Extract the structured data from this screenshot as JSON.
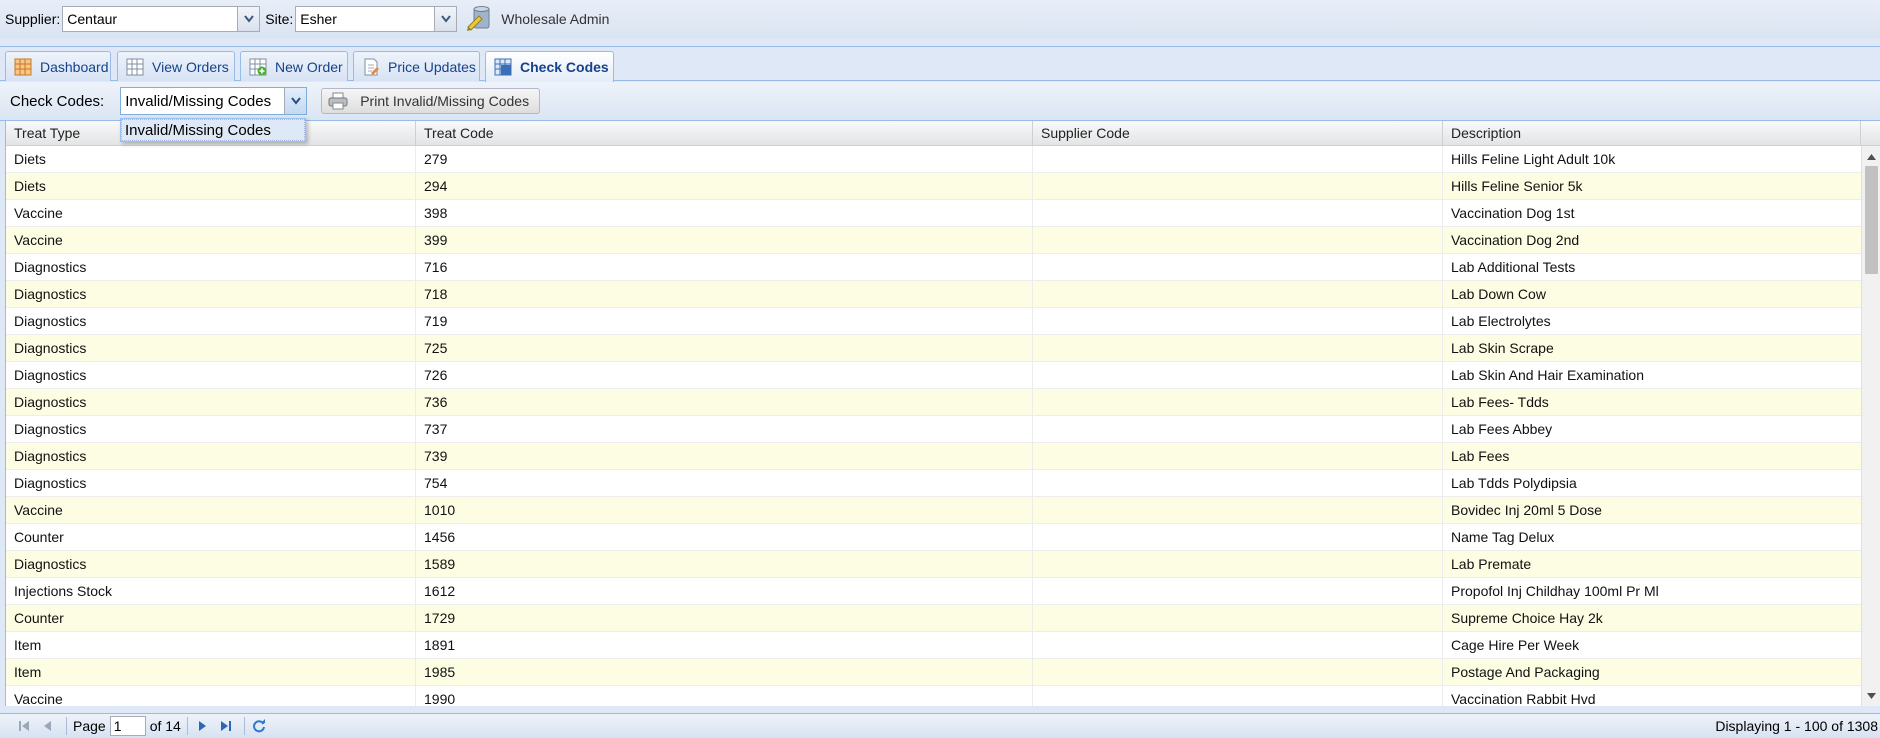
{
  "header": {
    "supplier_label": "Supplier:",
    "supplier_value": "Centaur",
    "site_label": "Site:",
    "site_value": "Esher",
    "admin_link": "Wholesale Admin"
  },
  "tabs": [
    {
      "label": "Dashboard",
      "icon": "dashboard-grid-icon",
      "active": false
    },
    {
      "label": "View Orders",
      "icon": "table-icon",
      "active": false
    },
    {
      "label": "New Order",
      "icon": "table-add-icon",
      "active": false
    },
    {
      "label": "Price Updates",
      "icon": "document-edit-icon",
      "active": false
    },
    {
      "label": "Check Codes",
      "icon": "table-check-icon",
      "active": true
    }
  ],
  "toolbar": {
    "check_codes_label": "Check Codes:",
    "check_codes_value": "Invalid/Missing Codes",
    "print_button": "Print Invalid/Missing Codes",
    "dropdown_options": [
      "Invalid/Missing Codes"
    ]
  },
  "grid": {
    "columns": [
      "Treat Type",
      "Treat Code",
      "Supplier Code",
      "Description"
    ],
    "rows": [
      [
        "Diets",
        "279",
        "",
        "Hills Feline Light Adult 10k"
      ],
      [
        "Diets",
        "294",
        "",
        "Hills Feline Senior 5k"
      ],
      [
        "Vaccine",
        "398",
        "",
        "Vaccination Dog 1st"
      ],
      [
        "Vaccine",
        "399",
        "",
        "Vaccination Dog 2nd"
      ],
      [
        "Diagnostics",
        "716",
        "",
        "Lab Additional Tests"
      ],
      [
        "Diagnostics",
        "718",
        "",
        "Lab Down Cow"
      ],
      [
        "Diagnostics",
        "719",
        "",
        "Lab Electrolytes"
      ],
      [
        "Diagnostics",
        "725",
        "",
        "Lab Skin Scrape"
      ],
      [
        "Diagnostics",
        "726",
        "",
        "Lab Skin And Hair Examination"
      ],
      [
        "Diagnostics",
        "736",
        "",
        "Lab Fees- Tdds"
      ],
      [
        "Diagnostics",
        "737",
        "",
        "Lab Fees Abbey"
      ],
      [
        "Diagnostics",
        "739",
        "",
        "Lab Fees"
      ],
      [
        "Diagnostics",
        "754",
        "",
        "Lab Tdds Polydipsia"
      ],
      [
        "Vaccine",
        "1010",
        "",
        "Bovidec Inj 20ml 5 Dose"
      ],
      [
        "Counter",
        "1456",
        "",
        "Name Tag Delux"
      ],
      [
        "Diagnostics",
        "1589",
        "",
        "Lab Premate"
      ],
      [
        "Injections Stock",
        "1612",
        "",
        "Propofol Inj Childhay 100ml Pr Ml"
      ],
      [
        "Counter",
        "1729",
        "",
        "Supreme Choice Hay 2k"
      ],
      [
        "Item",
        "1891",
        "",
        "Cage Hire Per Week"
      ],
      [
        "Item",
        "1985",
        "",
        "Postage And Packaging"
      ],
      [
        "Vaccine",
        "1990",
        "",
        "Vaccination Rabbit Hvd"
      ]
    ]
  },
  "paging": {
    "page_label": "Page",
    "page_value": "1",
    "of_label": "of 14",
    "display_info": "Displaying 1 - 100 of 1308"
  },
  "colors": {
    "accent": "#15428b",
    "border": "#99bbe8",
    "row_alt": "#fdfde3"
  }
}
